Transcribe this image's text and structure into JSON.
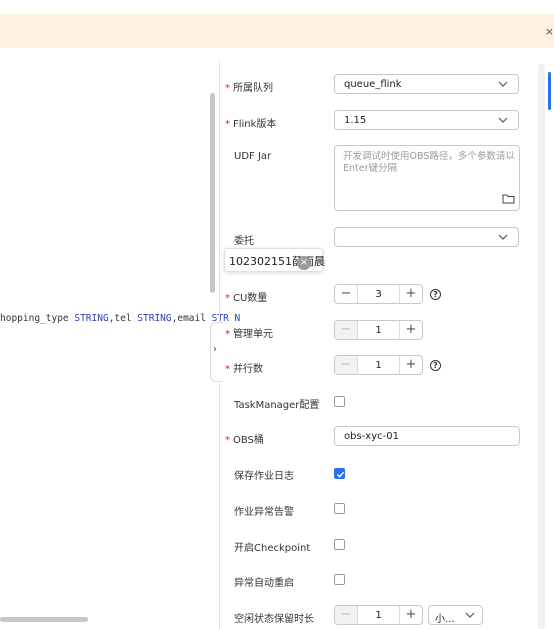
{
  "banner": {
    "close": "×"
  },
  "editor": {
    "code_fragments": [
      "hopping_type ",
      "STRING",
      ",tel ",
      "STRING",
      ",email ",
      "STR N"
    ]
  },
  "tooltip": {
    "text": "102302151薛雨晨",
    "close": "×"
  },
  "form": {
    "queue_label": "所属队列",
    "queue_value": "queue_flink",
    "flink_version_label": "Flink版本",
    "flink_version_value": "1.15",
    "udf_jar_label": "UDF Jar",
    "udf_jar_placeholder": "开发调试时使用OBS路径，多个参数请以Enter键分隔",
    "delegation_label": "委托",
    "delegation_value": "",
    "cu_label": "CU数量",
    "cu_value": "3",
    "mgmt_unit_label": "管理单元",
    "mgmt_unit_value": "1",
    "parallelism_label": "并行数",
    "parallelism_value": "1",
    "taskmanager_label": "TaskManager配置",
    "taskmanager_checked": false,
    "obs_label": "OBS桶",
    "obs_value": "obs-xyc-01",
    "save_log_label": "保存作业日志",
    "save_log_checked": true,
    "alarm_label": "作业异常告警",
    "alarm_checked": false,
    "checkpoint_label": "开启Checkpoint",
    "checkpoint_checked": false,
    "auto_restart_label": "异常自动重启",
    "auto_restart_checked": false,
    "idle_label": "空闲状态保留时长",
    "idle_value": "1",
    "idle_unit": "小..."
  },
  "required_mark": "*",
  "stepper_minus": "−",
  "stepper_plus": "+",
  "help_glyph": "?",
  "collapse_glyph": "›",
  "colors": {
    "accent": "#2b6ff3",
    "required": "#e02020",
    "banner": "#fdf1e1"
  }
}
